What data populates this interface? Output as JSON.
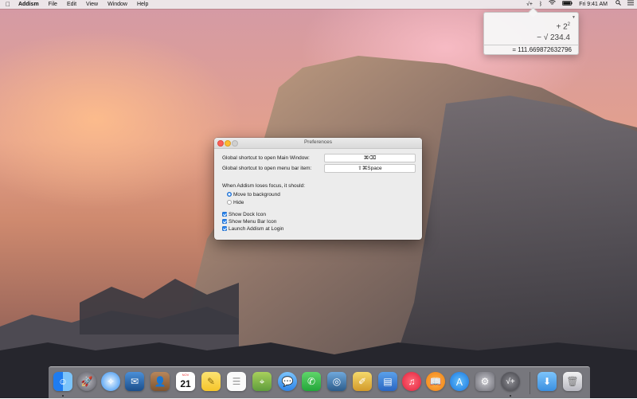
{
  "menubar": {
    "app_name": "Addism",
    "items": [
      "File",
      "Edit",
      "View",
      "Window",
      "Help"
    ],
    "status_addism_glyph": "√+",
    "clock": "Fri 9:41 AM"
  },
  "popover": {
    "line1_prefix": "+ 2",
    "line1_exp": "2",
    "line2": "− √ 234.4",
    "result": "= 111.669872632796"
  },
  "prefs": {
    "title": "Preferences",
    "main_window_label": "Global shortcut to open Main Window:",
    "main_window_shortcut": "⌘⌫",
    "menu_bar_label": "Global shortcut to open menu bar item:",
    "menu_bar_shortcut": "⇧⌘Space",
    "focus_label": "When Addism loses focus, it should:",
    "radio_move": "Move to background",
    "radio_hide": "Hide",
    "check_dock": "Show Dock Icon",
    "check_menubar": "Show Menu Bar Icon",
    "check_login": "Launch Addism at Login"
  },
  "dock": {
    "calendar_month": "NOV",
    "calendar_day": "21",
    "addism_glyph": "√+"
  },
  "colors": {
    "accent": "#2c86ee",
    "close": "#fc5f57",
    "minimize": "#fdbc2e"
  }
}
